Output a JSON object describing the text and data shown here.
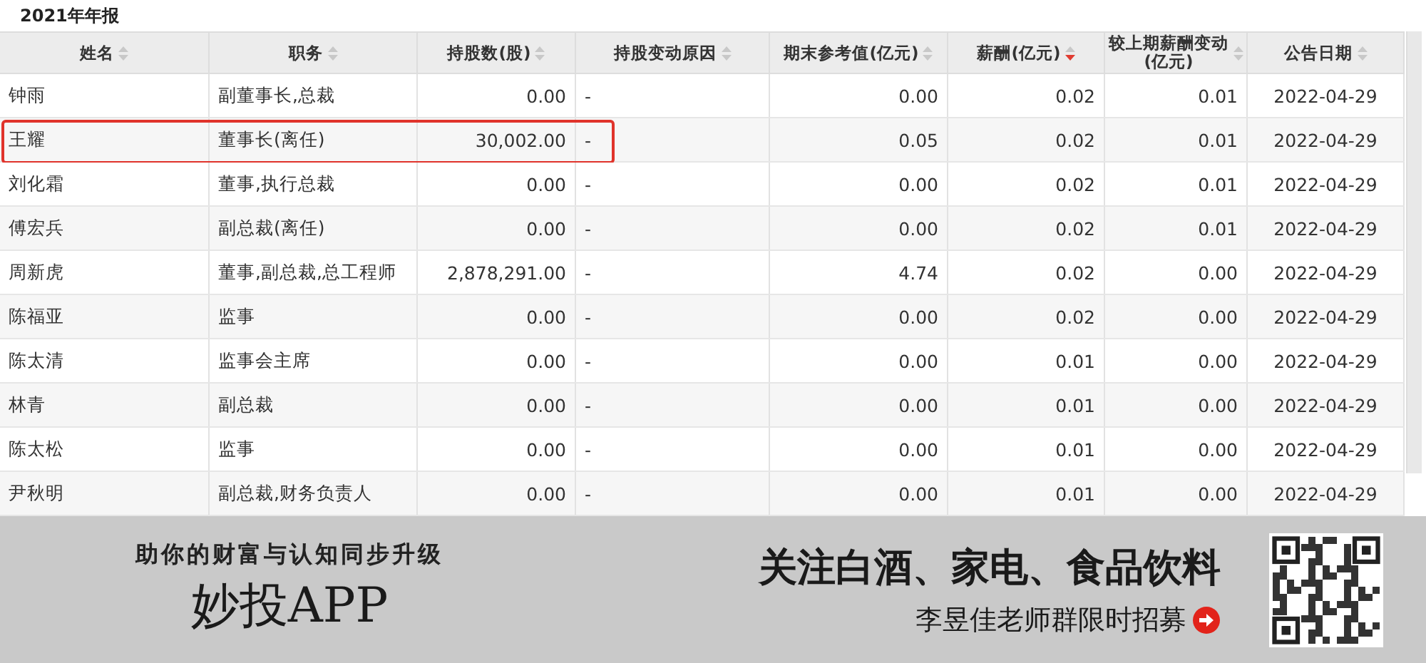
{
  "section_title": "2021年年报",
  "columns": [
    {
      "label": "姓名",
      "sorted": false
    },
    {
      "label": "职务",
      "sorted": false
    },
    {
      "label": "持股数(股)",
      "sorted": false
    },
    {
      "label": "持股变动原因",
      "sorted": false
    },
    {
      "label": "期末参考值(亿元)",
      "sorted": false
    },
    {
      "label": "薪酬(亿元)",
      "sorted": true
    },
    {
      "label": "较上期薪酬变动(亿元)",
      "sorted": false
    },
    {
      "label": "公告日期",
      "sorted": false
    }
  ],
  "rows": [
    {
      "cells": [
        "钟雨",
        "副董事长,总裁",
        "0.00",
        "-",
        "0.00",
        "0.02",
        "0.01",
        "2022-04-29"
      ],
      "highlighted": false
    },
    {
      "cells": [
        "王耀",
        "董事长(离任)",
        "30,002.00",
        "-",
        "0.05",
        "0.02",
        "0.01",
        "2022-04-29"
      ],
      "highlighted": true
    },
    {
      "cells": [
        "刘化霜",
        "董事,执行总裁",
        "0.00",
        "-",
        "0.00",
        "0.02",
        "0.01",
        "2022-04-29"
      ],
      "highlighted": false
    },
    {
      "cells": [
        "傅宏兵",
        "副总裁(离任)",
        "0.00",
        "-",
        "0.00",
        "0.02",
        "0.01",
        "2022-04-29"
      ],
      "highlighted": false
    },
    {
      "cells": [
        "周新虎",
        "董事,副总裁,总工程师",
        "2,878,291.00",
        "-",
        "4.74",
        "0.02",
        "0.00",
        "2022-04-29"
      ],
      "highlighted": false
    },
    {
      "cells": [
        "陈福亚",
        "监事",
        "0.00",
        "-",
        "0.00",
        "0.02",
        "0.00",
        "2022-04-29"
      ],
      "highlighted": false
    },
    {
      "cells": [
        "陈太清",
        "监事会主席",
        "0.00",
        "-",
        "0.00",
        "0.01",
        "0.00",
        "2022-04-29"
      ],
      "highlighted": false
    },
    {
      "cells": [
        "林青",
        "副总裁",
        "0.00",
        "-",
        "0.00",
        "0.01",
        "0.00",
        "2022-04-29"
      ],
      "highlighted": false
    },
    {
      "cells": [
        "陈太松",
        "监事",
        "0.00",
        "-",
        "0.00",
        "0.01",
        "0.00",
        "2022-04-29"
      ],
      "highlighted": false
    },
    {
      "cells": [
        "尹秋明",
        "副总裁,财务负责人",
        "0.00",
        "-",
        "0.00",
        "0.01",
        "0.00",
        "2022-04-29"
      ],
      "highlighted": false
    }
  ],
  "banner": {
    "slogan": "助你的财富与认知同步升级",
    "brand": "妙投APP",
    "headline": "关注白酒、家电、食品饮料",
    "cta": "李昱佳老师群限时招募"
  }
}
